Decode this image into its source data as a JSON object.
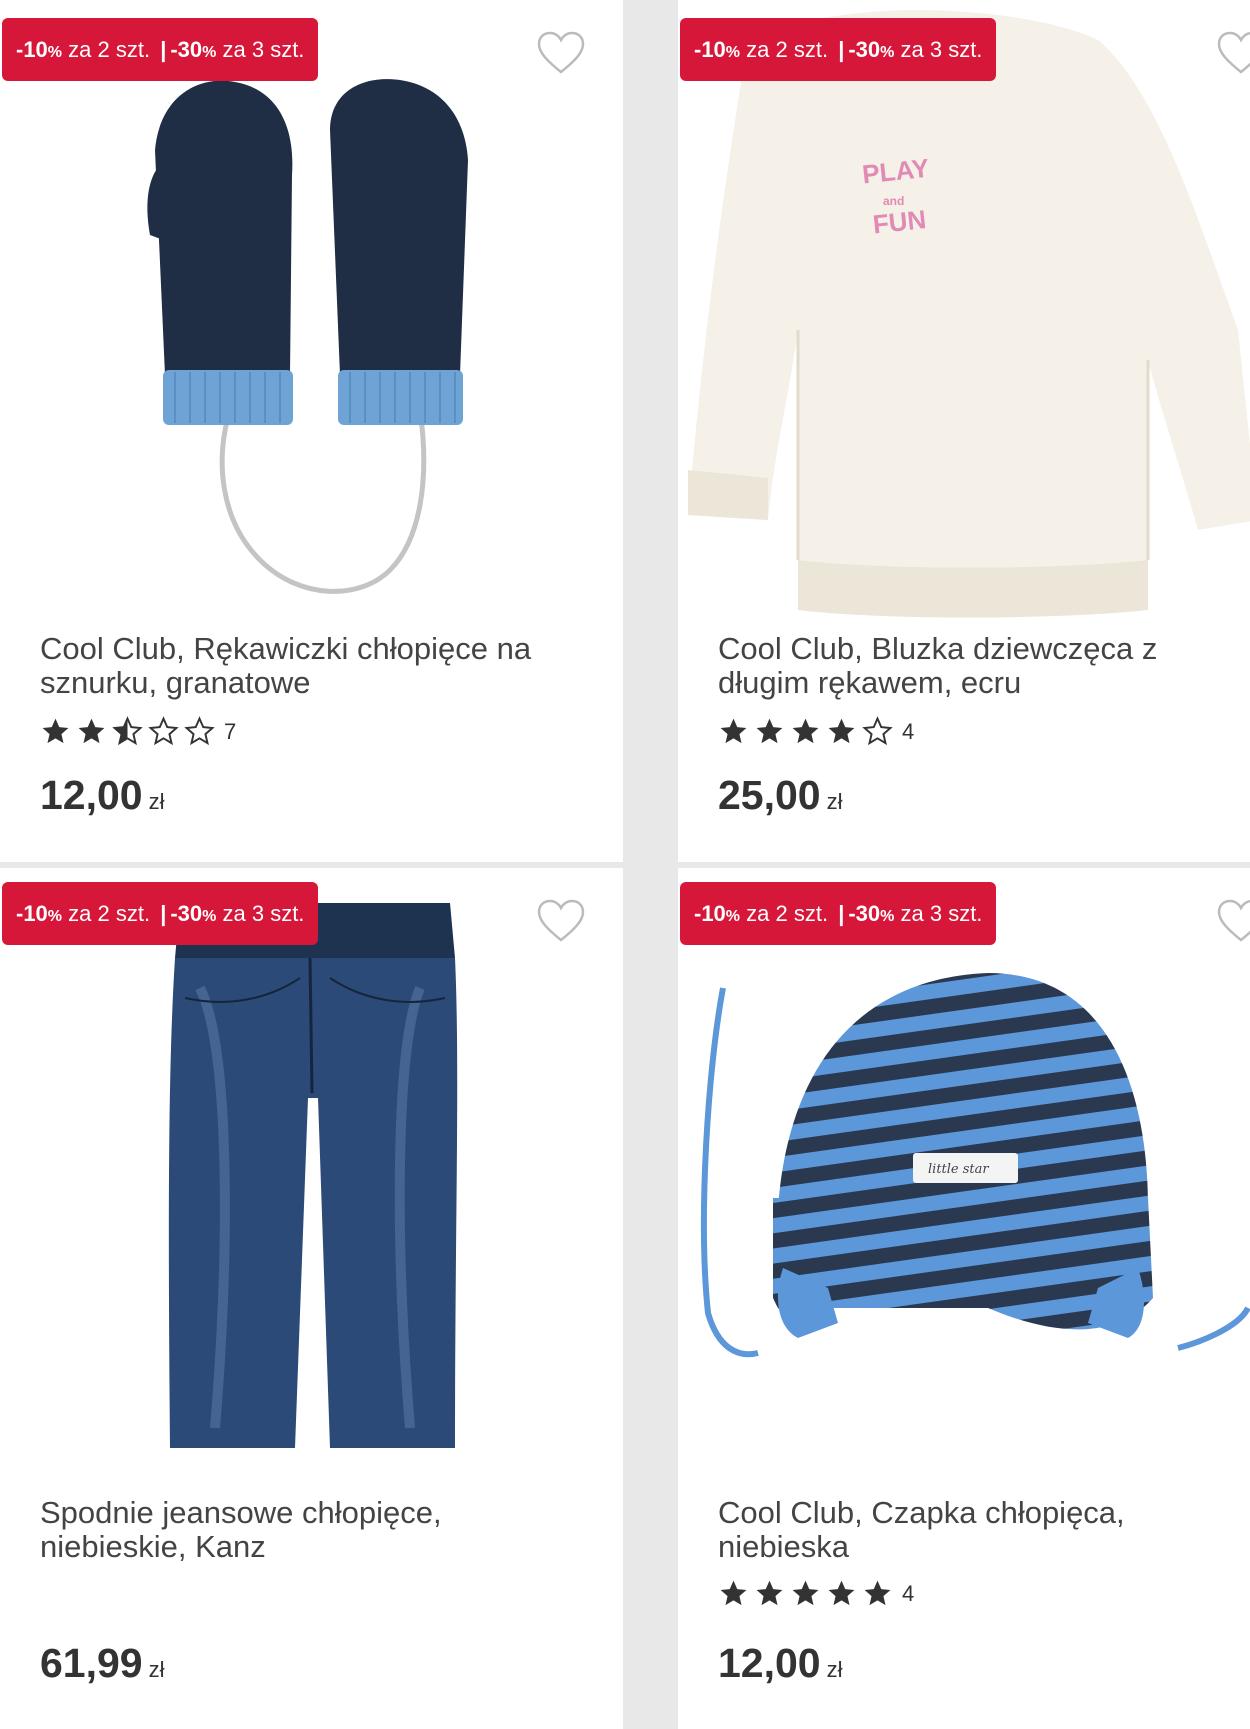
{
  "products": [
    {
      "promo": {
        "p1": "-10",
        "pct1": "%",
        "t1": " za 2 szt.",
        "sep": "|",
        "p2": "-30",
        "pct2": "%",
        "t2": " za 3 szt."
      },
      "title_line1": "Cool Club, Rękawiczki chłopięce na",
      "title_line2": "sznurku, granatowe",
      "rating": 2.5,
      "review_count": "7",
      "price": "12,00",
      "currency": "zł",
      "image": "navy-mittens"
    },
    {
      "promo": {
        "p1": "-10",
        "pct1": "%",
        "t1": " za 2 szt.",
        "sep": "|",
        "p2": "-30",
        "pct2": "%",
        "t2": " za 3 szt."
      },
      "title_line1": "Cool Club, Bluzka dziewczęca z",
      "title_line2": "długim rękawem, ecru",
      "rating": 4,
      "review_count": "4",
      "price": "25,00",
      "currency": "zł",
      "image": "ecru-sweatshirt",
      "print_text": "PLAY and FUN"
    },
    {
      "promo": {
        "p1": "-10",
        "pct1": "%",
        "t1": " za 2 szt.",
        "sep": "|",
        "p2": "-30",
        "pct2": "%",
        "t2": " za 3 szt."
      },
      "title_line1": "Spodnie jeansowe chłopięce,",
      "title_line2": "niebieskie, Kanz",
      "price": "61,99",
      "currency": "zł",
      "image": "blue-jeans"
    },
    {
      "promo": {
        "p1": "-10",
        "pct1": "%",
        "t1": " za 2 szt.",
        "sep": "|",
        "p2": "-30",
        "pct2": "%",
        "t2": " za 3 szt."
      },
      "title_line1": "Cool Club, Czapka chłopięca,",
      "title_line2": "niebieska",
      "rating": 5,
      "review_count": "4",
      "price": "12,00",
      "currency": "zł",
      "image": "striped-hat",
      "label_text": "little star"
    }
  ],
  "colors": {
    "promo_bg": "#d7173a",
    "star": "#333333",
    "text": "#444444"
  }
}
